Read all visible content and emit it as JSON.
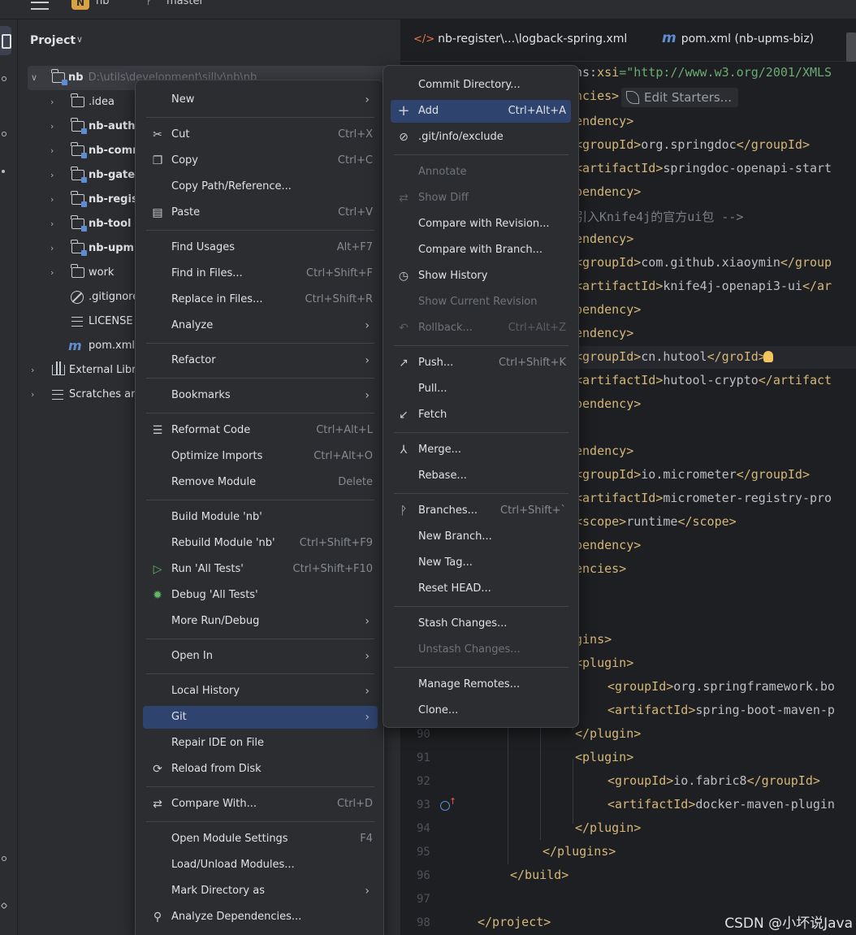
{
  "topbar": {
    "project_badge": "N",
    "project_name": "nb",
    "branch_name": "master"
  },
  "project_panel": {
    "title": "Project",
    "tree": [
      {
        "label": "nb",
        "path": "D:\\utils\\development\\silly\\nb\\nb"
      },
      {
        "label": ".idea"
      },
      {
        "label": "nb-auth"
      },
      {
        "label": "nb-comm"
      },
      {
        "label": "nb-gatew"
      },
      {
        "label": "nb-regis"
      },
      {
        "label": "nb-tool"
      },
      {
        "label": "nb-upm"
      },
      {
        "label": "work"
      },
      {
        "label": ".gitignore"
      },
      {
        "label": "LICENSE"
      },
      {
        "label": "pom.xml"
      },
      {
        "label": "External Libra"
      },
      {
        "label": "Scratches and"
      }
    ]
  },
  "editor": {
    "tabs": [
      {
        "icon": "</>",
        "label": "nb-register\\...\\logback-spring.xml"
      },
      {
        "icon": "m",
        "label": "pom.xml (nb-upms-biz)"
      }
    ],
    "edit_starters": "Edit Starters...",
    "line_numbers": [
      "90",
      "91",
      "92",
      "93",
      "94",
      "95",
      "96",
      "97",
      "98"
    ],
    "code": {
      "l1a": "ns:",
      "l1b": "xsi",
      "l1c": "=\"http://www.w3.org/2001/XMLS",
      "l2": "ncies>",
      "l3": "endency>",
      "l4a": "<groupId>",
      "l4b": "org.springdoc",
      "l4c": "</groupId>",
      "l5a": "<artifactId>",
      "l5b": "springdoc-openapi-start",
      "l6": "pendency>",
      "l7": "引入Knife4j的官方ui包 -->",
      "l8": "endency>",
      "l9a": "<groupId>",
      "l9b": "com.github.xiaoymin",
      "l9c": "</group",
      "l10a": "<artifactId>",
      "l10b": "knife4j-openapi3-ui",
      "l10c": "</ar",
      "l11": "pendency>",
      "l12": "endency>",
      "l13a": "<groupId>",
      "l13b": "cn.hutool",
      "l13c": "</gro",
      "l13d": "Id>",
      "l14a": "<artifactId>",
      "l14b": "hutool-crypto",
      "l14c": "</artifact",
      "l15": "pendency>",
      "l16": "endency>",
      "l17a": "<groupId>",
      "l17b": "io.micrometer",
      "l17c": "</groupId>",
      "l18a": "<artifactId>",
      "l18b": "micrometer-registry-pro",
      "l19a": "<scope>",
      "l19b": "runtime",
      "l19c": "</scope>",
      "l20": "pendency>",
      "l21": "encies>",
      "l22": "gins>",
      "l23": "<plugin>",
      "l24a": "<groupId>",
      "l24b": "org.springframework.bo",
      "l25a": "<artifactId>",
      "l25b": "spring-boot-maven-p",
      "l26": "</plugin>",
      "l27": "<plugin>",
      "l28a": "<groupId>",
      "l28b": "io.fabric8",
      "l28c": "</groupId>",
      "l29a": "<artifactId>",
      "l29b": "docker-maven-plugin",
      "l30": "</plugin>",
      "l31": "</plugins>",
      "l32": "</build>",
      "l33": "</project>"
    }
  },
  "context_menu": {
    "items": [
      {
        "label": "New",
        "submenu": true
      },
      {
        "label": "Cut",
        "shortcut": "Ctrl+X"
      },
      {
        "label": "Copy",
        "shortcut": "Ctrl+C"
      },
      {
        "label": "Copy Path/Reference..."
      },
      {
        "label": "Paste",
        "shortcut": "Ctrl+V"
      },
      {
        "label": "Find Usages",
        "shortcut": "Alt+F7"
      },
      {
        "label": "Find in Files...",
        "shortcut": "Ctrl+Shift+F"
      },
      {
        "label": "Replace in Files...",
        "shortcut": "Ctrl+Shift+R"
      },
      {
        "label": "Analyze",
        "submenu": true
      },
      {
        "label": "Refactor",
        "submenu": true
      },
      {
        "label": "Bookmarks",
        "submenu": true
      },
      {
        "label": "Reformat Code",
        "shortcut": "Ctrl+Alt+L"
      },
      {
        "label": "Optimize Imports",
        "shortcut": "Ctrl+Alt+O"
      },
      {
        "label": "Remove Module",
        "shortcut": "Delete"
      },
      {
        "label": "Build Module 'nb'"
      },
      {
        "label": "Rebuild Module 'nb'",
        "shortcut": "Ctrl+Shift+F9"
      },
      {
        "label": "Run 'All Tests'",
        "shortcut": "Ctrl+Shift+F10"
      },
      {
        "label": "Debug 'All Tests'"
      },
      {
        "label": "More Run/Debug",
        "submenu": true
      },
      {
        "label": "Open In",
        "submenu": true
      },
      {
        "label": "Local History",
        "submenu": true
      },
      {
        "label": "Git",
        "submenu": true
      },
      {
        "label": "Repair IDE on File"
      },
      {
        "label": "Reload from Disk"
      },
      {
        "label": "Compare With...",
        "shortcut": "Ctrl+D"
      },
      {
        "label": "Open Module Settings",
        "shortcut": "F4"
      },
      {
        "label": "Load/Unload Modules..."
      },
      {
        "label": "Mark Directory as",
        "submenu": true
      },
      {
        "label": "Analyze Dependencies..."
      }
    ]
  },
  "git_menu": {
    "items": [
      {
        "label": "Commit Directory..."
      },
      {
        "label": "Add",
        "shortcut": "Ctrl+Alt+A"
      },
      {
        "label": ".git/info/exclude"
      },
      {
        "label": "Annotate"
      },
      {
        "label": "Show Diff"
      },
      {
        "label": "Compare with Revision..."
      },
      {
        "label": "Compare with Branch..."
      },
      {
        "label": "Show History"
      },
      {
        "label": "Show Current Revision"
      },
      {
        "label": "Rollback...",
        "shortcut": "Ctrl+Alt+Z"
      },
      {
        "label": "Push...",
        "shortcut": "Ctrl+Shift+K"
      },
      {
        "label": "Pull..."
      },
      {
        "label": "Fetch"
      },
      {
        "label": "Merge..."
      },
      {
        "label": "Rebase..."
      },
      {
        "label": "Branches...",
        "shortcut": "Ctrl+Shift+`"
      },
      {
        "label": "New Branch..."
      },
      {
        "label": "New Tag..."
      },
      {
        "label": "Reset HEAD..."
      },
      {
        "label": "Stash Changes..."
      },
      {
        "label": "Unstash Changes..."
      },
      {
        "label": "Manage Remotes..."
      },
      {
        "label": "Clone..."
      }
    ]
  },
  "watermark": "CSDN @小坏说Java",
  "colors": {
    "accent": "#2e436e",
    "background": "#1e1f22",
    "panel": "#2b2d30",
    "tag": "#d5b778",
    "string": "#6aab73"
  }
}
